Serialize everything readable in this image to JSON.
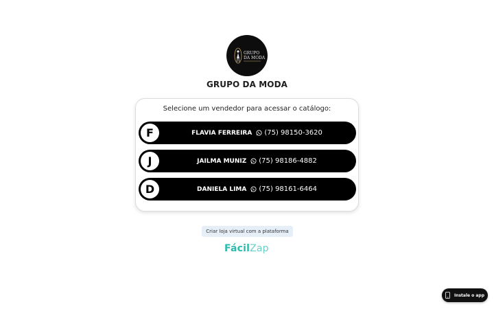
{
  "store": {
    "logo_text": [
      "GRUPO",
      "DA MODA"
    ],
    "name": "GRUPO DA MODA"
  },
  "card": {
    "title": "Selecione um vendedor para acessar o catálogo:"
  },
  "sellers": [
    {
      "initial": "F",
      "name": "FLAVIA FERREIRA",
      "phone": "(75) 98150-3620",
      "icon": "whatsapp-icon"
    },
    {
      "initial": "J",
      "name": "JAILMA MUNIZ",
      "phone": "(75) 98186-4882",
      "icon": "whatsapp-icon"
    },
    {
      "initial": "D",
      "name": "DANIELA LIMA",
      "phone": "(75) 98161-6464",
      "icon": "whatsapp-icon"
    }
  ],
  "footer": {
    "create_store_label": "Criar loja virtual com a plataforma",
    "brand_part1": "Fácil",
    "brand_part2": "Zap"
  },
  "install": {
    "label": "Instale o app",
    "icon": "smartphone-icon"
  },
  "colors": {
    "seller_bg": "#000000",
    "brand_teal": "#2bbbad",
    "create_btn_bg": "#e6eef8"
  }
}
